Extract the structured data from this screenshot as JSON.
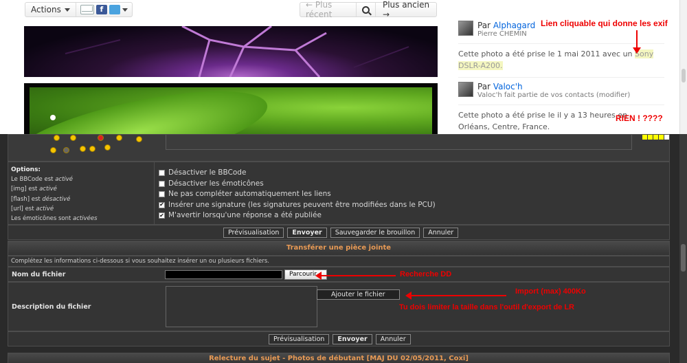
{
  "topbar": {
    "actions_label": "Actions",
    "prev_label": "← Plus récent",
    "next_label": "Plus ancien →"
  },
  "sidebar": {
    "by_prefix": "Par",
    "owner": {
      "name": "Alphagard",
      "realname": "Pierre CHEMIN"
    },
    "exif_text": "Cette photo a été prise le 1 mai 2011 avec un",
    "camera_link_1": "Sony",
    "camera_link_2": "DSLR-A200.",
    "viewer": {
      "name": "Valoc'h",
      "note": "Valoc'h fait partie de vos contacts (modifier)"
    },
    "location_text": "Cette photo a été prise le il y a 13 heures en",
    "location_text2": "Orléans, Centre, France."
  },
  "annotations": {
    "exif_note": "Lien cliquable qui donne les exif",
    "rien": "RIEN ! ????",
    "search_dd": "Recherche DD",
    "import_max": "Import (max) 400Ko",
    "resize_hint": "Tu dois limiter la taille dans l'outil d'export de LR"
  },
  "options": {
    "heading": "Options:",
    "lines": [
      {
        "pre": "Le BBCode est ",
        "em": "activé"
      },
      {
        "pre": "[img] est ",
        "em": "activé"
      },
      {
        "pre": "[flash] est ",
        "em": "désactivé"
      },
      {
        "pre": "[url] est ",
        "em": "activé"
      },
      {
        "pre": "Les émoticônes sont ",
        "em": "activées"
      }
    ],
    "checkboxes": [
      {
        "label": "Désactiver le BBCode",
        "checked": false
      },
      {
        "label": "Désactiver les émoticônes",
        "checked": false
      },
      {
        "label": "Ne pas compléter automatiquement les liens",
        "checked": false
      },
      {
        "label": "Insérer une signature (les signatures peuvent être modifiées dans le PCU)",
        "checked": true
      },
      {
        "label": "M'avertir lorsqu'une réponse a été publiée",
        "checked": true
      }
    ]
  },
  "buttons": {
    "preview": "Prévisualisation",
    "submit": "Envoyer",
    "save_draft": "Sauvegarder le brouillon",
    "cancel": "Annuler",
    "browse": "Parcourir...",
    "add_file": "Ajouter le fichier"
  },
  "attachment": {
    "header": "Transférer une pièce jointe",
    "intro": "Complétez les informations ci-dessous si vous souhaitez insérer un ou plusieurs fichiers.",
    "filename_label": "Nom du fichier",
    "desc_label": "Description du fichier"
  },
  "bottom_header": "Relecture du sujet - Photos de débutant [MAJ DU 02/05/2011, Coxi]"
}
